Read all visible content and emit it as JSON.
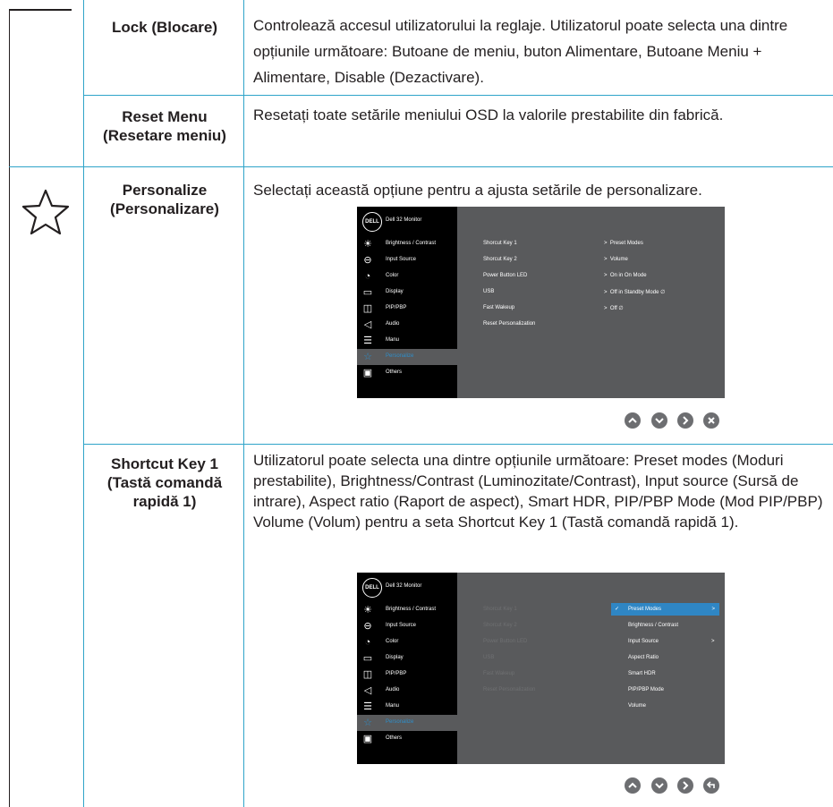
{
  "rows": [
    {
      "name": "Lock (Blocare)",
      "desc": "Controlează accesul utilizatorului la reglaje. Utilizatorul poate selecta una dintre opțiunile următoare: Butoane de meniu, buton Alimentare, Butoane Meniu + Alimentare, Disable (Dezactivare)."
    },
    {
      "name": "Reset Menu (Resetare meniu)",
      "desc": "Resetați toate setările meniului OSD la valorile prestabilite din fabrică."
    },
    {
      "name": "Personalize (Personalizare)",
      "desc": "Selectați această opțiune pentru a ajusta setările de personalizare."
    },
    {
      "name": "Shortcut Key 1 (Tastă comandă rapidă 1)",
      "desc": "Utilizatorul poate selecta una dintre opțiunile următoare: Preset modes (Moduri prestabilite), Brightness/Contrast (Luminozitate/Contrast), Input source (Sursă de intrare), Aspect ratio (Raport de aspect), Smart HDR, PIP/PBP Mode (Mod PIP/PBP) Volume (Volum) pentru a seta Shortcut Key 1 (Tastă comandă rapidă 1)."
    }
  ],
  "osd": {
    "logo": "DELL",
    "title": "Dell 32 Monitor",
    "menu": [
      "Brightness / Contrast",
      "Input Source",
      "Color",
      "Display",
      "PIP/PBP",
      "Audio",
      "Manu",
      "Personalize",
      "Others"
    ],
    "menu_icons": [
      "brightness-icon",
      "input-source-icon",
      "color-icon",
      "display-icon",
      "pip-pbp-icon",
      "audio-icon",
      "menu-icon",
      "star-icon",
      "others-icon"
    ],
    "settings": [
      "Shorcut Key 1",
      "Shorcut Key 2",
      "Power Button LED",
      "USB",
      "Fast Wakeup",
      "Reset Personalization"
    ],
    "values": [
      "Preset Modes",
      "Volume",
      "On in On Mode",
      "Off in Standby Mode",
      "Off"
    ],
    "submenu": [
      "Preset Modes",
      "Brightness / Contrast",
      "Input Source",
      "Aspect Ratio",
      "Smart HDR",
      "PIP/PBP Mode",
      "Volume"
    ]
  },
  "colors": {
    "accent": "#2fa4c9",
    "osd_bg": "#595a5c",
    "osd_left": "#000000",
    "highlight": "#2f86c4"
  }
}
